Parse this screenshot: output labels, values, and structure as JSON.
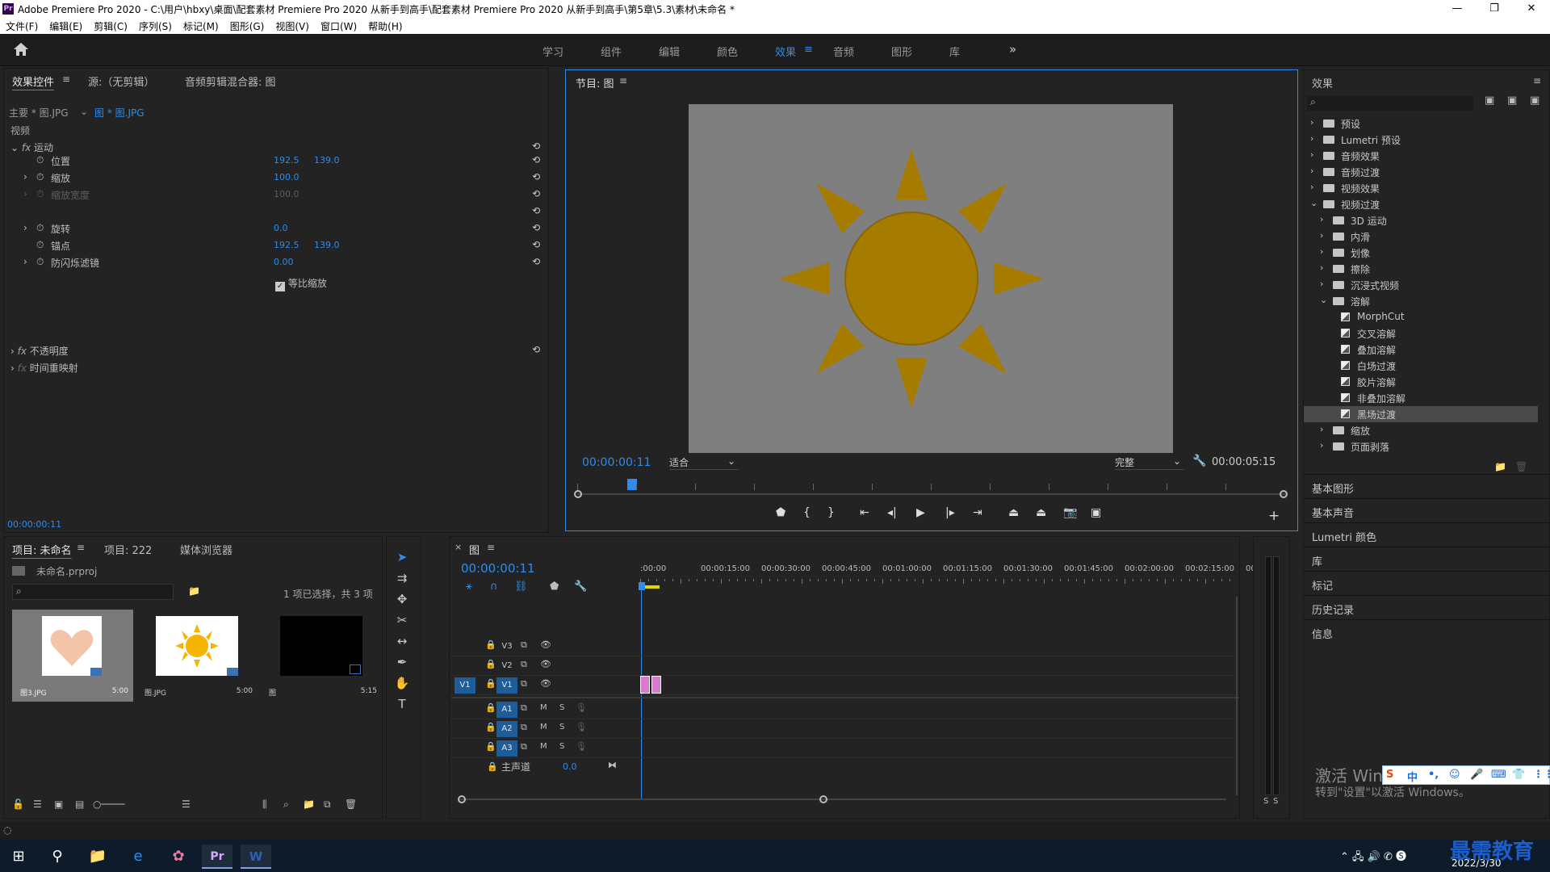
{
  "window": {
    "title": "Adobe Premiere Pro 2020 - C:\\用户\\hbxy\\桌面\\配套素材 Premiere Pro 2020 从新手到高手\\配套素材 Premiere Pro 2020 从新手到高手\\第5章\\5.3\\素材\\未命名 *",
    "app_icon": "Pr",
    "minimize": "—",
    "maximize": "❐",
    "close": "✕"
  },
  "menu": [
    "文件(F)",
    "编辑(E)",
    "剪辑(C)",
    "序列(S)",
    "标记(M)",
    "图形(G)",
    "视图(V)",
    "窗口(W)",
    "帮助(H)"
  ],
  "workspaces": {
    "tabs": [
      "学习",
      "组件",
      "编辑",
      "颜色",
      "效果",
      "音频",
      "图形",
      "库"
    ],
    "active": "效果",
    "more": "»"
  },
  "effect_controls": {
    "tabs": [
      "效果控件",
      "源:（无剪辑）",
      "音频剪辑混合器: 图"
    ],
    "master": "主要 * 图.JPG",
    "clip": "图 * 图.JPG",
    "section": "视频",
    "motion": "运动",
    "props": [
      {
        "name": "位置",
        "v1": "192.5",
        "v2": "139.0"
      },
      {
        "name": "缩放",
        "v1": "100.0",
        "v2": ""
      },
      {
        "name": "缩放宽度",
        "v1": "100.0",
        "v2": ""
      },
      {
        "name": "",
        "v1": "",
        "v2": ""
      },
      {
        "name": "旋转",
        "v1": "0.0",
        "v2": ""
      },
      {
        "name": "锚点",
        "v1": "192.5",
        "v2": "139.0"
      },
      {
        "name": "防闪烁滤镜",
        "v1": "0.00",
        "v2": ""
      }
    ],
    "uniform_scale": "等比缩放",
    "opacity": "不透明度",
    "time_remap": "时间重映射",
    "timecode": "00:00:00:11"
  },
  "program": {
    "title": "节目: 图",
    "timecode": "00:00:00:11",
    "fit": "适合",
    "quality": "完整",
    "duration": "00:00:05:15"
  },
  "project": {
    "tabs": [
      "项目: 未命名",
      "项目: 222",
      "媒体浏览器"
    ],
    "file": "未命名.prproj",
    "selection": "1 项已选择，共 3 项",
    "items": [
      {
        "name": "图3.JPG",
        "dur": "5:00"
      },
      {
        "name": "图.JPG",
        "dur": "5:00"
      },
      {
        "name": "图",
        "dur": "5:15"
      }
    ]
  },
  "timeline": {
    "tab": "图",
    "timecode": "00:00:00:11",
    "ruler": [
      ":00:00",
      "00:00:15:00",
      "00:00:30:00",
      "00:00:45:00",
      "00:01:00:00",
      "00:01:15:00",
      "00:01:30:00",
      "00:01:45:00",
      "00:02:00:00",
      "00:02:15:00",
      "00:"
    ],
    "video_tracks": [
      "V3",
      "V2",
      "V1"
    ],
    "audio_tracks": [
      "A1",
      "A2",
      "A3"
    ],
    "source_v": "V1",
    "master": "主声道",
    "master_val": "0.0",
    "m": "M",
    "s": "S"
  },
  "effects": {
    "title": "效果",
    "tree": [
      {
        "label": "预设",
        "depth": 0,
        "open": false,
        "kind": "folder"
      },
      {
        "label": "Lumetri 预设",
        "depth": 0,
        "open": false,
        "kind": "folder"
      },
      {
        "label": "音频效果",
        "depth": 0,
        "open": false,
        "kind": "folder"
      },
      {
        "label": "音频过渡",
        "depth": 0,
        "open": false,
        "kind": "folder"
      },
      {
        "label": "视频效果",
        "depth": 0,
        "open": false,
        "kind": "folder"
      },
      {
        "label": "视频过渡",
        "depth": 0,
        "open": true,
        "kind": "folder"
      },
      {
        "label": "3D 运动",
        "depth": 1,
        "open": false,
        "kind": "folder"
      },
      {
        "label": "内滑",
        "depth": 1,
        "open": false,
        "kind": "folder"
      },
      {
        "label": "划像",
        "depth": 1,
        "open": false,
        "kind": "folder"
      },
      {
        "label": "擦除",
        "depth": 1,
        "open": false,
        "kind": "folder"
      },
      {
        "label": "沉浸式视频",
        "depth": 1,
        "open": false,
        "kind": "folder"
      },
      {
        "label": "溶解",
        "depth": 1,
        "open": true,
        "kind": "folder"
      },
      {
        "label": "MorphCut",
        "depth": 2,
        "kind": "preset"
      },
      {
        "label": "交叉溶解",
        "depth": 2,
        "kind": "preset"
      },
      {
        "label": "叠加溶解",
        "depth": 2,
        "kind": "preset"
      },
      {
        "label": "白场过渡",
        "depth": 2,
        "kind": "preset"
      },
      {
        "label": "胶片溶解",
        "depth": 2,
        "kind": "preset"
      },
      {
        "label": "非叠加溶解",
        "depth": 2,
        "kind": "preset"
      },
      {
        "label": "黑场过渡",
        "depth": 2,
        "kind": "preset",
        "selected": true
      },
      {
        "label": "缩放",
        "depth": 1,
        "open": false,
        "kind": "folder"
      },
      {
        "label": "页面剥落",
        "depth": 1,
        "open": false,
        "kind": "folder"
      }
    ],
    "sections": [
      "基本图形",
      "基本声音",
      "Lumetri 颜色",
      "库",
      "标记",
      "历史记录",
      "信息"
    ]
  },
  "activation": {
    "line1": "激活 Windows",
    "line2": "转到\"设置\"以激活 Windows。"
  },
  "ime": {
    "items": [
      "S",
      "中",
      "•,",
      "☺",
      "🎤",
      "⌨",
      "👕",
      "⋮⋮"
    ]
  },
  "watermark": "最需教育",
  "taskbar": {
    "date": "2022/3/30",
    "apps": [
      "⊞",
      "⚲",
      "📁",
      "e",
      "✿",
      "Pr",
      "W"
    ]
  },
  "colors": {
    "accent": "#2d8ceb",
    "sun": "#a67c00",
    "sky": "#7f7f7f",
    "clip": "#d87bd0"
  }
}
